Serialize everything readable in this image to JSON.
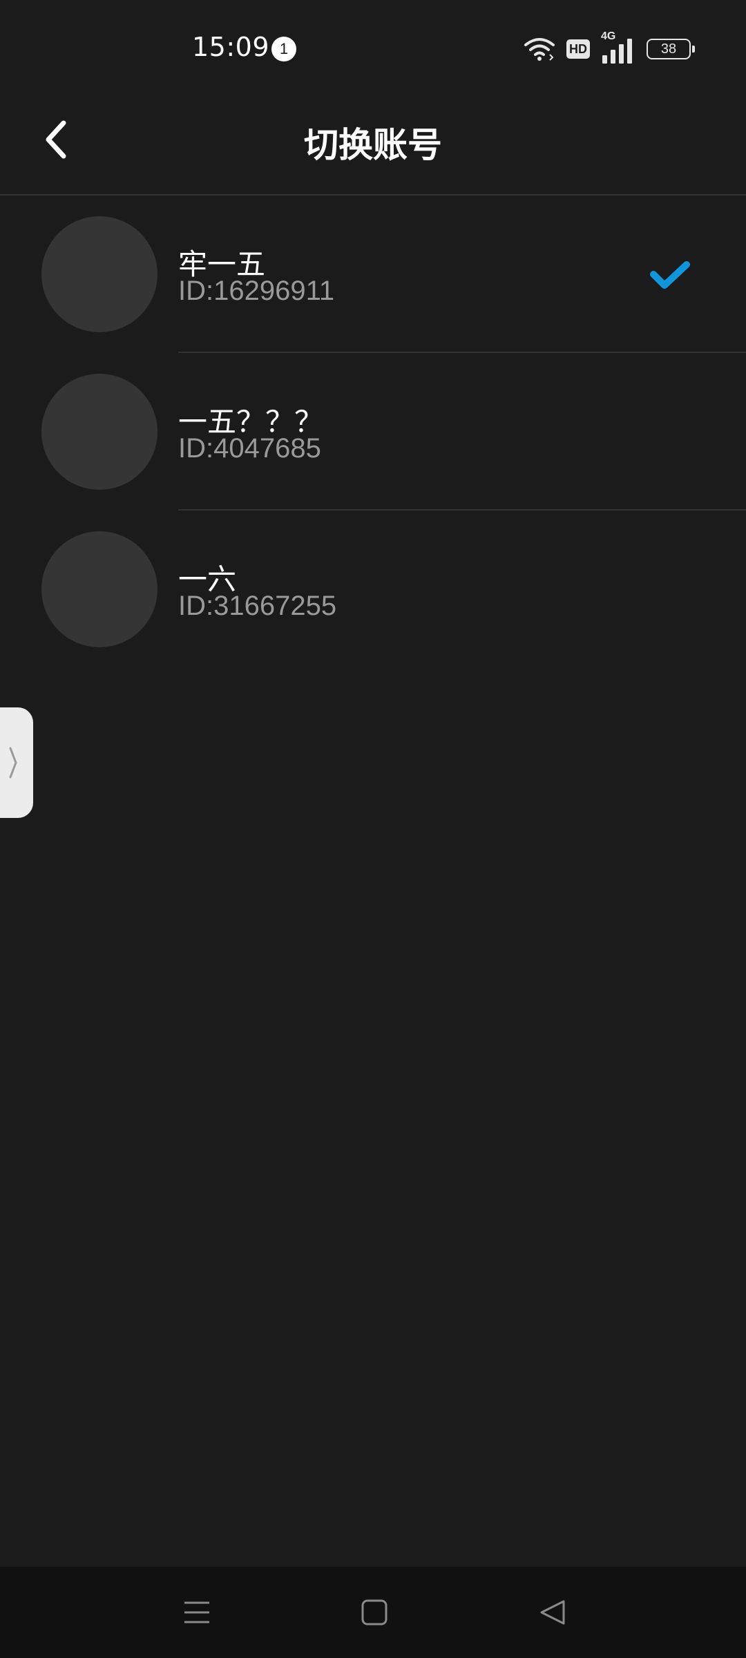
{
  "status_bar": {
    "time": "15:09",
    "notification_count": "1",
    "hd_label": "HD",
    "network_label": "4G",
    "battery_level": "38"
  },
  "header": {
    "title": "切换账号",
    "back_icon": "chevron-left-icon"
  },
  "accounts": [
    {
      "name": "牢一五",
      "id": "ID:16296911",
      "selected": true
    },
    {
      "name": "一五？？？",
      "id": "ID:4047685",
      "selected": false
    },
    {
      "name": "一六",
      "id": "ID:31667255",
      "selected": false
    }
  ],
  "colors": {
    "background": "#1b1b1b",
    "accent_check": "#1296db",
    "secondary_text": "#9a9a9a",
    "avatar_placeholder": "#353535",
    "nav_bar": "#111111"
  },
  "nav_bar": {
    "icons": [
      "menu-icon",
      "home-icon",
      "back-triangle-icon"
    ]
  }
}
